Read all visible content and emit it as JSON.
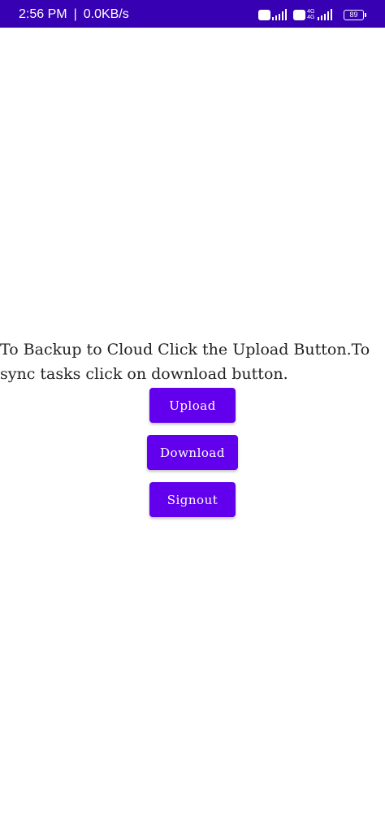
{
  "status_bar": {
    "time": "2:56 PM",
    "separator": "|",
    "net_speed": "0.0KB/s",
    "volte_label": "Vo LTE",
    "net_type_top": "4G",
    "net_type_bottom": "4G",
    "battery_level": "89",
    "background_color": "#3700b3"
  },
  "main": {
    "message": "To Backup to Cloud Click the Upload Button.To sync tasks click on download button.",
    "buttons": {
      "upload_label": "Upload",
      "download_label": "Download",
      "signout_label": "Signout"
    },
    "button_color": "#6200ee"
  }
}
